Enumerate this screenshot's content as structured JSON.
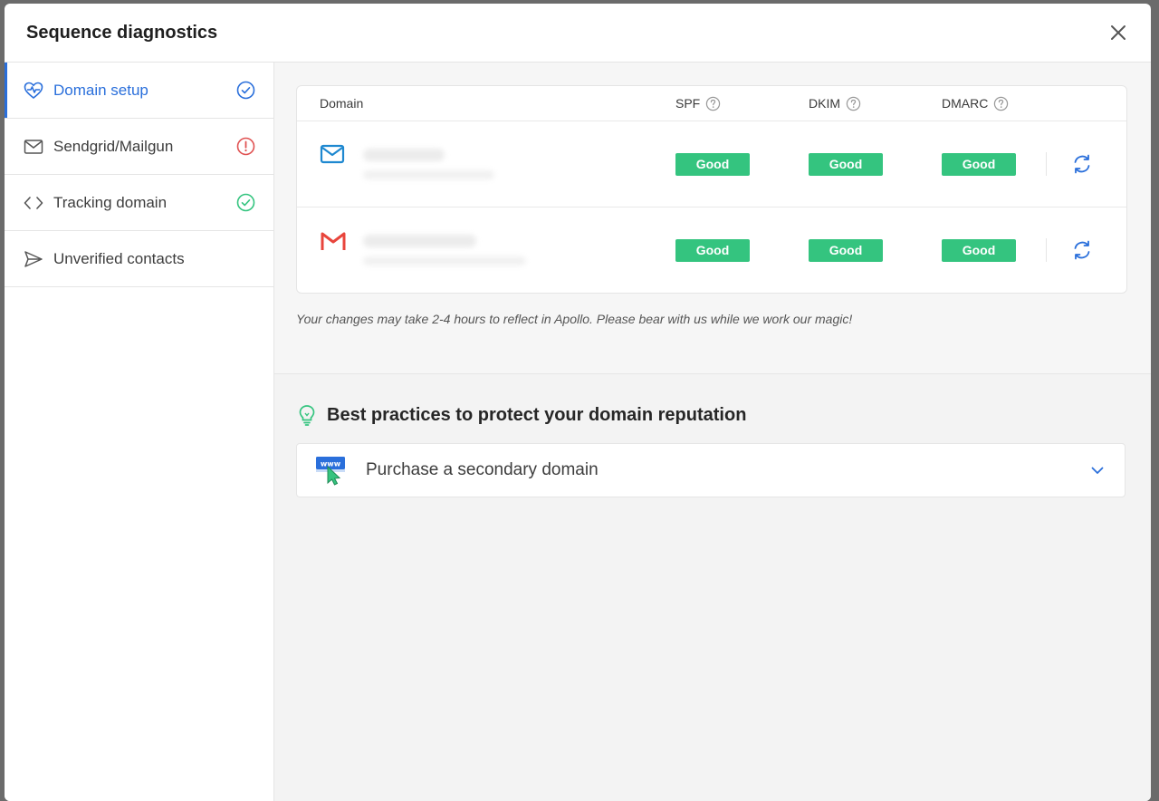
{
  "modal": {
    "title": "Sequence diagnostics",
    "close_icon": "close-icon"
  },
  "sidebar": {
    "items": [
      {
        "label": "Domain setup",
        "icon": "heart-pulse-icon",
        "status": "check",
        "active": true
      },
      {
        "label": "Sendgrid/Mailgun",
        "icon": "envelope-icon",
        "status": "error",
        "active": false
      },
      {
        "label": "Tracking domain",
        "icon": "code-icon",
        "status": "check",
        "active": false
      },
      {
        "label": "Unverified contacts",
        "icon": "send-icon",
        "status": "none",
        "active": false
      }
    ]
  },
  "table": {
    "headers": {
      "domain": "Domain",
      "spf": "SPF",
      "dkim": "DKIM",
      "dmarc": "DMARC"
    },
    "rows": [
      {
        "provider_icon": "outlook-mail-icon",
        "spf": "Good",
        "dkim": "Good",
        "dmarc": "Good"
      },
      {
        "provider_icon": "gmail-icon",
        "spf": "Good",
        "dkim": "Good",
        "dmarc": "Good"
      }
    ]
  },
  "note": "Your changes may take 2-4 hours to reflect in Apollo. Please bear with us while we work our magic!",
  "practices": {
    "title": "Best practices to protect your domain reputation",
    "items": [
      {
        "label": "Purchase a secondary domain",
        "icon": "www-cursor-icon"
      }
    ]
  },
  "colors": {
    "accent": "#2a6fdb",
    "good": "#34c47f",
    "error": "#e05252",
    "success": "#34c47f"
  }
}
